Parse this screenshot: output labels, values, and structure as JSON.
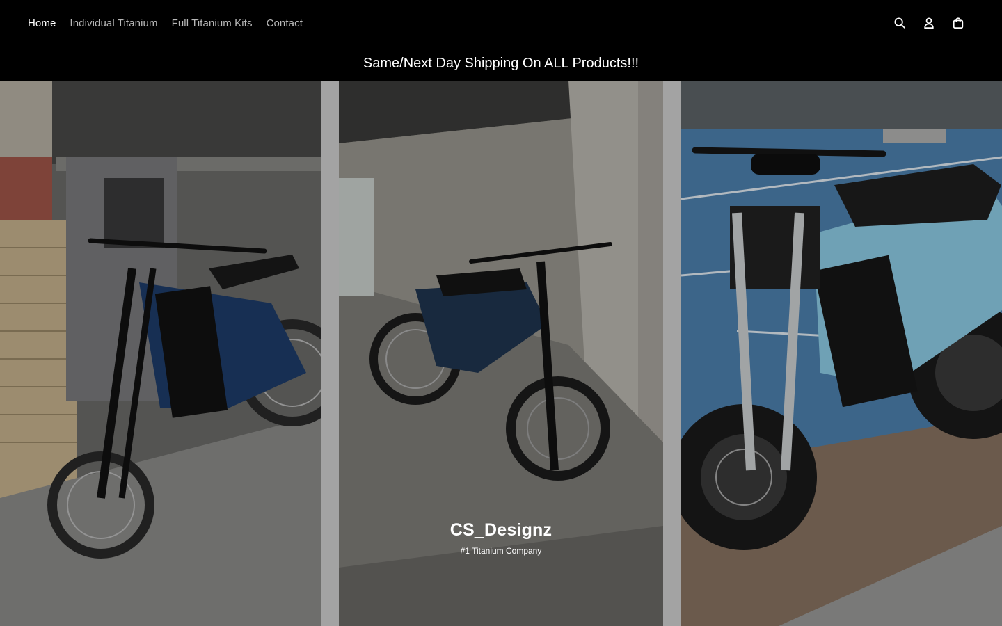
{
  "nav": {
    "items": [
      {
        "label": "Home",
        "active": true
      },
      {
        "label": "Individual Titanium",
        "active": false
      },
      {
        "label": "Full Titanium Kits",
        "active": false
      },
      {
        "label": "Contact",
        "active": false
      }
    ]
  },
  "header_icons": [
    "search-icon",
    "account-icon",
    "cart-icon"
  ],
  "announcement": "Same/Next Day Shipping On ALL Products!!!",
  "hero": {
    "title": "CS_Designz",
    "subtitle": "#1 Titanium Company"
  },
  "colors": {
    "background": "#000000",
    "nav_active": "#ffffff",
    "nav_inactive": "#b8b8b8",
    "gutter": "#a3a3a3"
  }
}
